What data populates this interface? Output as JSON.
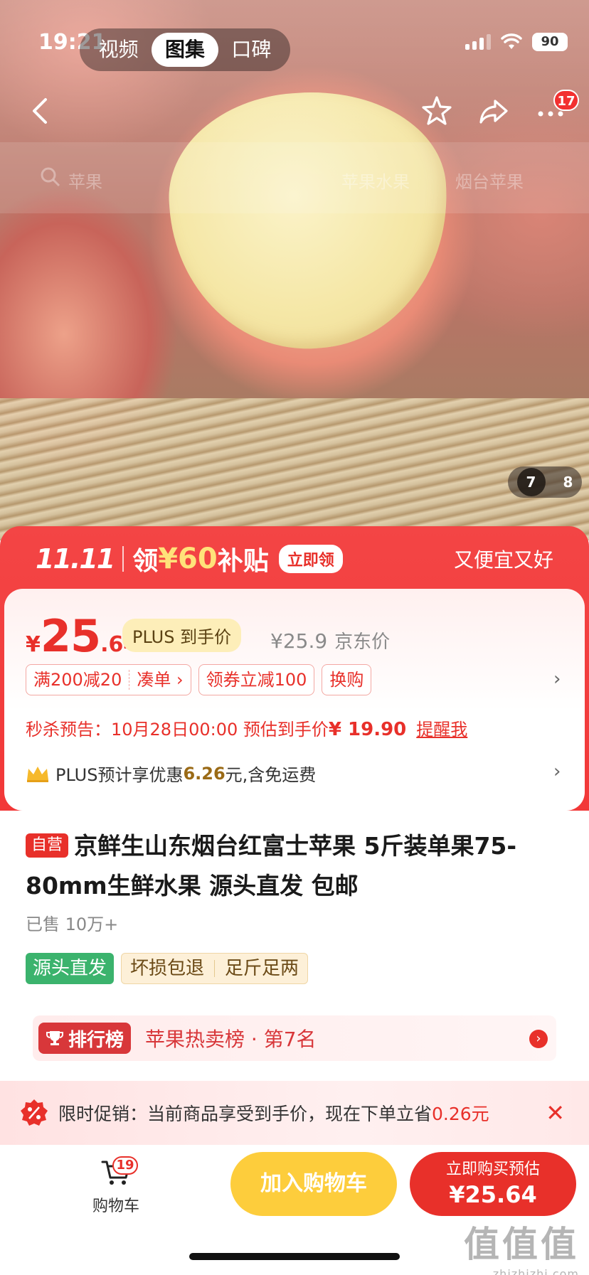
{
  "status_bar": {
    "time": "19:21",
    "battery": "90"
  },
  "media_tabs": [
    {
      "label": "视频"
    },
    {
      "label": "图集"
    },
    {
      "label": "口碑"
    }
  ],
  "nav": {
    "more_badge": "17"
  },
  "search_ghost": {
    "placeholder": "苹果",
    "suggest_1": "苹果水果",
    "suggest_2": "烟台苹果"
  },
  "gallery": {
    "current": "7",
    "total": "8"
  },
  "promo_banner": {
    "logo": "11.11",
    "text_prefix": "领",
    "amount": "¥60",
    "text_suffix": "补贴",
    "button": "立即领",
    "slogan": "又便宜又好"
  },
  "price": {
    "currency": "¥",
    "integer": "25",
    "decimal": ".64",
    "plus_label": "PLUS 到手价",
    "jd_price": "¥25.9",
    "jd_price_label": "京东价"
  },
  "coupons": {
    "full_reduce": "满200减20",
    "add_on": "凑单 ›",
    "coupon_reduce": "领券立减100",
    "trade_in": "换购"
  },
  "seckill": {
    "prefix": "秒杀预告：",
    "time": "10月28日00:00",
    "middle": "预估到手价",
    "price": "¥ 19.90",
    "remind": "提醒我"
  },
  "plus_line": {
    "prefix": "PLUS预计享优惠",
    "amount": "6.26",
    "suffix": "元,含免运费"
  },
  "product": {
    "self_tag": "自营",
    "title": "京鲜生山东烟台红富士苹果 5斤装单果75-80mm生鲜水果 源头直发 包邮",
    "sold": "已售 10万+"
  },
  "tags": {
    "green": "源头直发",
    "beige_1": "坏损包退",
    "beige_2": "足斤足两"
  },
  "ranking": {
    "badge": "排行榜",
    "text": "苹果热卖榜 · 第7名"
  },
  "flash_promo": {
    "prefix": "限时促销：当前商品享受到手价，现在下单立省",
    "amount": "0.26元"
  },
  "bottom": {
    "cart_badge": "19",
    "cart_label": "购物车",
    "add_to_cart": "加入购物车",
    "buy_line1": "立即购买预估",
    "buy_line2": "¥25.64"
  },
  "watermark": {
    "line1": "值值值",
    "line2": "zhizhizhi.com"
  },
  "colors": {
    "brand_red": "#e8302a",
    "promo_red": "#f34545",
    "cart_yellow": "#fdcd3c",
    "green_tag": "#3bb36d"
  }
}
